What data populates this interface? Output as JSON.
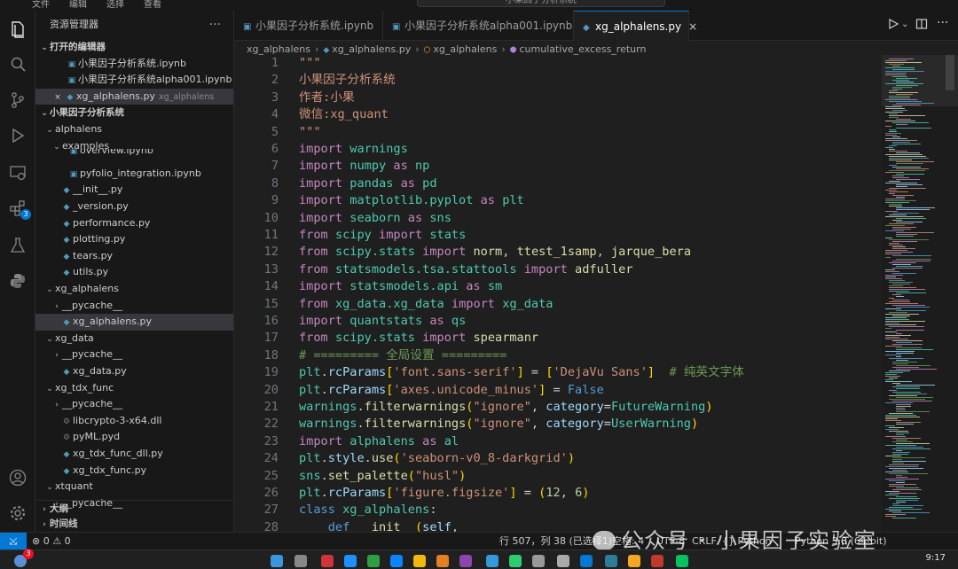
{
  "titlebar": {
    "menus": [
      "文件",
      "编辑",
      "选择",
      "查看"
    ],
    "search": "小果因子分析系统"
  },
  "activity": {
    "icons": [
      "files-icon",
      "search-icon",
      "source-control-icon",
      "run-debug-icon",
      "remote-explorer-icon",
      "extensions-icon",
      "testing-icon",
      "python-icon",
      "account-icon",
      "settings-icon"
    ],
    "extensions_badge": "3"
  },
  "sidebar": {
    "title": "资源管理器",
    "more": "···",
    "open_editors_label": "打开的编辑器",
    "open_editors": [
      {
        "name": "小果因子分析系统.ipynb",
        "kind": "notebook"
      },
      {
        "name": "小果因子分析系统alpha001.ipynb",
        "kind": "notebook"
      },
      {
        "name": "xg_alphalens.py",
        "kind": "python",
        "desc": "xg_alphalens"
      }
    ],
    "project_label": "小果因子分析系统",
    "tree": [
      {
        "label": "alphalens",
        "depth": 1,
        "type": "folder-open"
      },
      {
        "label": "examples",
        "depth": 2,
        "type": "folder-open"
      },
      {
        "label": "overview.ipynb",
        "depth": 3,
        "type": "notebook"
      },
      {
        "label": "pyfolio_integration.ipynb",
        "depth": 3,
        "type": "notebook"
      },
      {
        "label": "__init__.py",
        "depth": 2,
        "type": "python"
      },
      {
        "label": "_version.py",
        "depth": 2,
        "type": "python"
      },
      {
        "label": "performance.py",
        "depth": 2,
        "type": "python"
      },
      {
        "label": "plotting.py",
        "depth": 2,
        "type": "python"
      },
      {
        "label": "tears.py",
        "depth": 2,
        "type": "python"
      },
      {
        "label": "utils.py",
        "depth": 2,
        "type": "python"
      },
      {
        "label": "xg_alphalens",
        "depth": 1,
        "type": "folder-open"
      },
      {
        "label": "__pycache__",
        "depth": 2,
        "type": "folder-closed"
      },
      {
        "label": "xg_alphalens.py",
        "depth": 2,
        "type": "python",
        "selected": true
      },
      {
        "label": "xg_data",
        "depth": 1,
        "type": "folder-open"
      },
      {
        "label": "__pycache__",
        "depth": 2,
        "type": "folder-closed"
      },
      {
        "label": "xg_data.py",
        "depth": 2,
        "type": "python"
      },
      {
        "label": "xg_tdx_func",
        "depth": 1,
        "type": "folder-open"
      },
      {
        "label": "__pycache__",
        "depth": 2,
        "type": "folder-closed"
      },
      {
        "label": "libcrypto-3-x64.dll",
        "depth": 2,
        "type": "dll"
      },
      {
        "label": "pyML.pyd",
        "depth": 2,
        "type": "pyd"
      },
      {
        "label": "xg_tdx_func_dll.py",
        "depth": 2,
        "type": "python"
      },
      {
        "label": "xg_tdx_func.py",
        "depth": 2,
        "type": "python"
      },
      {
        "label": "xtquant",
        "depth": 1,
        "type": "folder-open"
      },
      {
        "label": "__pycache__",
        "depth": 2,
        "type": "folder-closed"
      }
    ],
    "outline_label": "大纲",
    "timeline_label": "时间线"
  },
  "tabs": [
    {
      "label": "小果因子分析系统.ipynb",
      "kind": "notebook",
      "active": false
    },
    {
      "label": "小果因子分析系统alpha001.ipynb",
      "kind": "notebook",
      "active": false
    },
    {
      "label": "xg_alphalens.py",
      "kind": "python",
      "active": true,
      "close": "×"
    }
  ],
  "breadcrumb": [
    "xg_alphalens",
    "xg_alphalens.py",
    "xg_alphalens",
    "cumulative_excess_return"
  ],
  "editor": {
    "lines": [
      {
        "n": "1",
        "t": [
          [
            "doc",
            "\"\"\""
          ]
        ]
      },
      {
        "n": "2",
        "t": [
          [
            "doc",
            "小果因子分析系统"
          ]
        ]
      },
      {
        "n": "3",
        "t": [
          [
            "doc",
            "作者:小果"
          ]
        ]
      },
      {
        "n": "4",
        "t": [
          [
            "doc",
            "微信:xg_quant"
          ]
        ]
      },
      {
        "n": "5",
        "t": [
          [
            "doc",
            "\"\"\""
          ]
        ]
      },
      {
        "n": "6",
        "t": [
          [
            "kw",
            "import"
          ],
          [
            "",
            " "
          ],
          [
            "mod",
            "warnings"
          ]
        ]
      },
      {
        "n": "7",
        "t": [
          [
            "kw",
            "import"
          ],
          [
            "",
            " "
          ],
          [
            "mod",
            "numpy"
          ],
          [
            "",
            " "
          ],
          [
            "kw",
            "as"
          ],
          [
            "",
            " "
          ],
          [
            "mod",
            "np"
          ]
        ]
      },
      {
        "n": "8",
        "t": [
          [
            "kw",
            "import"
          ],
          [
            "",
            " "
          ],
          [
            "mod",
            "pandas"
          ],
          [
            "",
            " "
          ],
          [
            "kw",
            "as"
          ],
          [
            "",
            " "
          ],
          [
            "mod",
            "pd"
          ]
        ]
      },
      {
        "n": "9",
        "t": [
          [
            "kw",
            "import"
          ],
          [
            "",
            " "
          ],
          [
            "mod",
            "matplotlib.pyplot"
          ],
          [
            "",
            " "
          ],
          [
            "kw",
            "as"
          ],
          [
            "",
            " "
          ],
          [
            "mod",
            "plt"
          ]
        ]
      },
      {
        "n": "10",
        "t": [
          [
            "kw",
            "import"
          ],
          [
            "",
            " "
          ],
          [
            "mod",
            "seaborn"
          ],
          [
            "",
            " "
          ],
          [
            "kw",
            "as"
          ],
          [
            "",
            " "
          ],
          [
            "mod",
            "sns"
          ]
        ]
      },
      {
        "n": "11",
        "t": [
          [
            "kw",
            "from"
          ],
          [
            "",
            " "
          ],
          [
            "mod",
            "scipy"
          ],
          [
            "",
            " "
          ],
          [
            "kw",
            "import"
          ],
          [
            "",
            " "
          ],
          [
            "mod",
            "stats"
          ]
        ]
      },
      {
        "n": "12",
        "t": [
          [
            "kw",
            "from"
          ],
          [
            "",
            " "
          ],
          [
            "mod",
            "scipy.stats"
          ],
          [
            "",
            " "
          ],
          [
            "kw",
            "import"
          ],
          [
            "",
            " "
          ],
          [
            "fn",
            "norm"
          ],
          [
            "",
            ", "
          ],
          [
            "fn",
            "ttest_1samp"
          ],
          [
            "",
            ", "
          ],
          [
            "fn",
            "jarque_bera"
          ]
        ]
      },
      {
        "n": "13",
        "t": [
          [
            "kw",
            "from"
          ],
          [
            "",
            " "
          ],
          [
            "mod",
            "statsmodels.tsa.stattools"
          ],
          [
            "",
            " "
          ],
          [
            "kw",
            "import"
          ],
          [
            "",
            " "
          ],
          [
            "fn",
            "adfuller"
          ]
        ]
      },
      {
        "n": "14",
        "t": [
          [
            "kw",
            "import"
          ],
          [
            "",
            " "
          ],
          [
            "mod",
            "statsmodels.api"
          ],
          [
            "",
            " "
          ],
          [
            "kw",
            "as"
          ],
          [
            "",
            " "
          ],
          [
            "mod",
            "sm"
          ]
        ]
      },
      {
        "n": "15",
        "t": [
          [
            "kw",
            "from"
          ],
          [
            "",
            " "
          ],
          [
            "mod",
            "xg_data.xg_data"
          ],
          [
            "",
            " "
          ],
          [
            "kw",
            "import"
          ],
          [
            "",
            " "
          ],
          [
            "mod",
            "xg_data"
          ]
        ]
      },
      {
        "n": "16",
        "t": [
          [
            "kw",
            "import"
          ],
          [
            "",
            " "
          ],
          [
            "mod",
            "quantstats"
          ],
          [
            "",
            " "
          ],
          [
            "kw",
            "as"
          ],
          [
            "",
            " "
          ],
          [
            "mod",
            "qs"
          ]
        ]
      },
      {
        "n": "17",
        "t": [
          [
            "kw",
            "from"
          ],
          [
            "",
            " "
          ],
          [
            "mod",
            "scipy.stats"
          ],
          [
            "",
            " "
          ],
          [
            "kw",
            "import"
          ],
          [
            "",
            " "
          ],
          [
            "fn",
            "spearmanr"
          ]
        ]
      },
      {
        "n": "18",
        "t": [
          [
            "cmt",
            "# ========= 全局设置 ========="
          ]
        ]
      },
      {
        "n": "19",
        "t": [
          [
            "mod",
            "plt"
          ],
          [
            "",
            "."
          ],
          [
            "id",
            "rcParams"
          ],
          [
            "pun",
            "["
          ],
          [
            "str",
            "'font.sans-serif'"
          ],
          [
            "pun",
            "]"
          ],
          [
            "",
            " = "
          ],
          [
            "pun",
            "["
          ],
          [
            "str",
            "'DejaVu Sans'"
          ],
          [
            "pun",
            "]"
          ],
          [
            "",
            "  "
          ],
          [
            "cmt",
            "# 纯英文字体"
          ]
        ]
      },
      {
        "n": "20",
        "t": [
          [
            "mod",
            "plt"
          ],
          [
            "",
            "."
          ],
          [
            "id",
            "rcParams"
          ],
          [
            "pun",
            "["
          ],
          [
            "str",
            "'axes.unicode_minus'"
          ],
          [
            "pun",
            "]"
          ],
          [
            "",
            " = "
          ],
          [
            "bool",
            "False"
          ]
        ]
      },
      {
        "n": "21",
        "t": [
          [
            "mod",
            "warnings"
          ],
          [
            "",
            "."
          ],
          [
            "fn",
            "filterwarnings"
          ],
          [
            "pun",
            "("
          ],
          [
            "str",
            "\"ignore\""
          ],
          [
            "",
            ", "
          ],
          [
            "id",
            "category"
          ],
          [
            "",
            "="
          ],
          [
            "mod",
            "FutureWarning"
          ],
          [
            "pun",
            ")"
          ]
        ]
      },
      {
        "n": "22",
        "t": [
          [
            "mod",
            "warnings"
          ],
          [
            "",
            "."
          ],
          [
            "fn",
            "filterwarnings"
          ],
          [
            "pun",
            "("
          ],
          [
            "str",
            "\"ignore\""
          ],
          [
            "",
            ", "
          ],
          [
            "id",
            "category"
          ],
          [
            "",
            "="
          ],
          [
            "mod",
            "UserWarning"
          ],
          [
            "pun",
            ")"
          ]
        ]
      },
      {
        "n": "23",
        "t": [
          [
            "kw",
            "import"
          ],
          [
            "",
            " "
          ],
          [
            "mod",
            "alphalens"
          ],
          [
            "",
            " "
          ],
          [
            "kw",
            "as"
          ],
          [
            "",
            " "
          ],
          [
            "mod",
            "al"
          ]
        ]
      },
      {
        "n": "24",
        "t": [
          [
            "mod",
            "plt"
          ],
          [
            "",
            "."
          ],
          [
            "id",
            "style"
          ],
          [
            "",
            "."
          ],
          [
            "fn",
            "use"
          ],
          [
            "pun",
            "("
          ],
          [
            "str",
            "'seaborn-v0_8-darkgrid'"
          ],
          [
            "pun",
            ")"
          ]
        ]
      },
      {
        "n": "25",
        "t": [
          [
            "mod",
            "sns"
          ],
          [
            "",
            "."
          ],
          [
            "fn",
            "set_palette"
          ],
          [
            "pun",
            "("
          ],
          [
            "str",
            "\"husl\""
          ],
          [
            "pun",
            ")"
          ]
        ]
      },
      {
        "n": "26",
        "t": [
          [
            "mod",
            "plt"
          ],
          [
            "",
            "."
          ],
          [
            "id",
            "rcParams"
          ],
          [
            "pun",
            "["
          ],
          [
            "str",
            "'figure.figsize'"
          ],
          [
            "pun",
            "]"
          ],
          [
            "",
            " = "
          ],
          [
            "pun",
            "("
          ],
          [
            "num",
            "12"
          ],
          [
            "",
            ", "
          ],
          [
            "num",
            "6"
          ],
          [
            "pun",
            ")"
          ]
        ]
      },
      {
        "n": "27",
        "t": [
          [
            "bool",
            "class"
          ],
          [
            "",
            " "
          ],
          [
            "mod",
            "xg_alphalens"
          ],
          [
            "",
            ":"
          ]
        ]
      },
      {
        "n": "28",
        "t": [
          [
            "",
            "    "
          ],
          [
            "bool",
            "def"
          ],
          [
            "",
            " "
          ],
          [
            "fn",
            "__init__"
          ],
          [
            "pun",
            "("
          ],
          [
            "id",
            "self"
          ],
          [
            "",
            ","
          ]
        ]
      }
    ]
  },
  "statusbar": {
    "remote": "⤩",
    "problems": "⊗ 0 ⚠ 0",
    "cursor": "行 507，列 38 (已选择1)",
    "spaces": "空格: 4",
    "encoding": "UTF-8",
    "eol": "CRLF",
    "language": "{} Python",
    "interpreter": "Python 3.8 (64-bit)"
  },
  "watermark": "公众号 · 小果因子实验室",
  "taskbar": {
    "clock": "9:17",
    "badge": "3"
  },
  "colors": {
    "accent": "#0078d4",
    "bg": "#1f1f1f",
    "sidebar": "#181818"
  }
}
